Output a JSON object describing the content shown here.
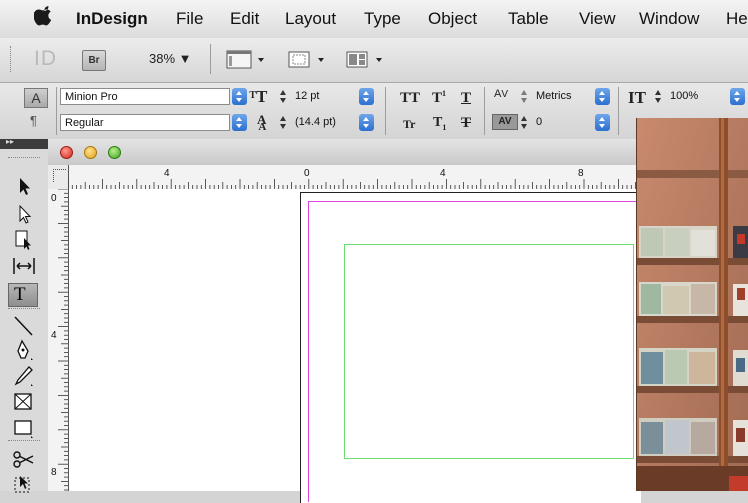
{
  "menubar": {
    "app_name": "InDesign",
    "items": [
      "File",
      "Edit",
      "Layout",
      "Type",
      "Object",
      "Table",
      "View",
      "Window",
      "He"
    ]
  },
  "app_bar": {
    "logo": "ID",
    "bridge_label": "Br",
    "zoom": "38% ▼"
  },
  "character_control": {
    "font_family": "Minion Pro",
    "font_style": "Regular",
    "font_size": "12 pt",
    "leading": "(14.4 pt)",
    "kerning": "Metrics",
    "tracking": "0",
    "vertical_scale": "100%"
  },
  "rulers": {
    "horizontal": [
      "4",
      "0",
      "4",
      "8"
    ],
    "vertical": [
      "0",
      "4",
      "8"
    ]
  },
  "colors": {
    "margin_guide": "#dd44dd",
    "frame_guide": "#6fdc6f",
    "popup_blue": "#3a7bd5"
  },
  "icons": {
    "apple": "apple-icon",
    "window_controls": [
      "close-light",
      "minimize-light",
      "zoom-light"
    ],
    "tools": [
      "selection-tool-icon",
      "direct-selection-tool-icon",
      "page-tool-icon",
      "gap-tool-icon",
      "type-tool-icon",
      "line-tool-icon",
      "pen-tool-icon",
      "pencil-tool-icon",
      "rectangle-frame-tool-icon",
      "rectangle-tool-icon",
      "scissors-tool-icon",
      "free-transform-tool-icon"
    ]
  }
}
